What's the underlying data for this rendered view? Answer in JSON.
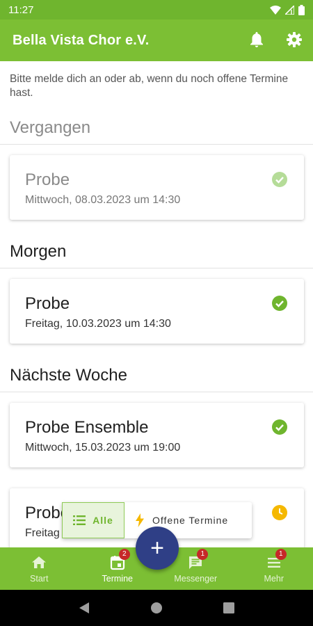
{
  "status_bar": {
    "time": "11:27"
  },
  "app_bar": {
    "title": "Bella Vista Chor e.V."
  },
  "hint": "Bitte melde dich an oder ab, wenn du noch offene Termine hast.",
  "sections": {
    "past": "Vergangen",
    "tomorrow": "Morgen",
    "next_week": "Nächste Woche"
  },
  "events": [
    {
      "title": "Probe",
      "date": "Mittwoch, 08.03.2023 um 14:30",
      "status": "accepted"
    },
    {
      "title": "Probe",
      "date": "Freitag, 10.03.2023 um 14:30",
      "status": "accepted"
    },
    {
      "title": "Probe Ensemble",
      "date": "Mittwoch, 15.03.2023 um 19:00",
      "status": "accepted"
    },
    {
      "title": "Probe",
      "date": "Freitag",
      "status": "pending"
    }
  ],
  "filter": {
    "all_label": "Alle",
    "open_label": "Offene Termine"
  },
  "bottom_nav": {
    "start": "Start",
    "termine": "Termine",
    "termine_badge": "2",
    "messenger": "Messenger",
    "messenger_badge": "1",
    "mehr": "Mehr",
    "mehr_badge": "1"
  },
  "fab_label": "+",
  "colors": {
    "primary": "#7cbf34",
    "accent": "#2f3f86",
    "accepted": "#6fb52e",
    "pending": "#f5b800",
    "badge": "#c62828"
  }
}
